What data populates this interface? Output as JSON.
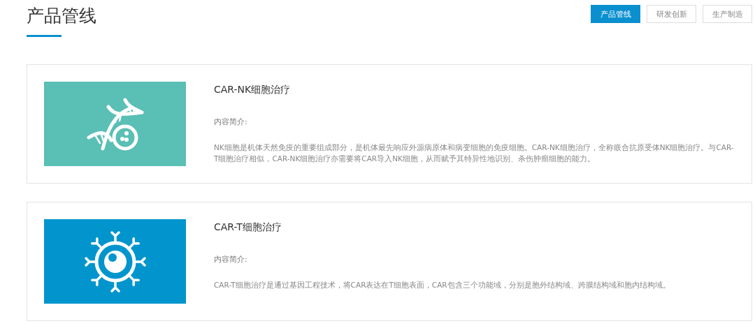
{
  "title": "产品管线",
  "tabs": [
    {
      "label": "产品管线",
      "selected": true
    },
    {
      "label": "研发创新",
      "selected": false
    },
    {
      "label": "生产制造",
      "selected": false
    }
  ],
  "products": [
    {
      "kind": "dna",
      "name": "CAR-NK细胞治疗",
      "intro_label": "内容简介:",
      "description": "NK细胞是机体天然免疫的重要组成部分，是机体最先响应外源病原体和病变细胞的免疫细胞。CAR-NK细胞治疗，全称嵌合抗原受体NK细胞治疗。与CAR-T细胞治疗相似，CAR-NK细胞治疗亦需要将CAR导入NK细胞，从而赋予其特异性地识别、杀伤肿瘤细胞的能力。"
    },
    {
      "kind": "cell",
      "name": "CAR-T细胞治疗",
      "intro_label": "内容简介:",
      "description": "CAR-T细胞治疗是通过基因工程技术，将CAR表达在T细胞表面，CAR包含三个功能域，分别是胞外结构域、跨膜结构域和胞内结构域。"
    }
  ]
}
